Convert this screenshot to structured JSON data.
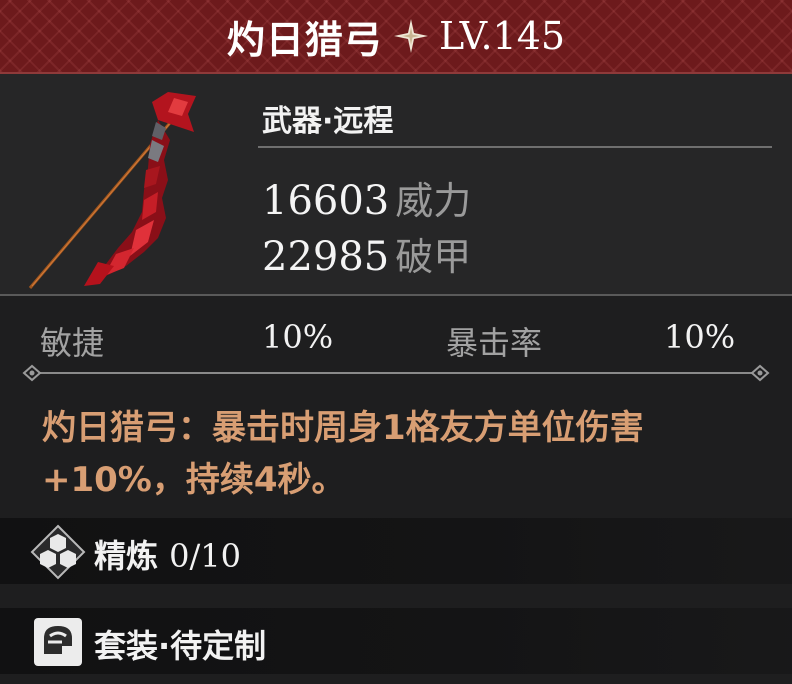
{
  "header": {
    "title": "灼日猎弓",
    "level": "LV.145",
    "star_icon": "sparkle-star-icon"
  },
  "item": {
    "image_icon": "red-crystal-bow-icon",
    "category": "武器·远程",
    "stats": [
      {
        "value": "16603",
        "label": "威力"
      },
      {
        "value": "22985",
        "label": "破甲"
      }
    ]
  },
  "attributes": [
    {
      "name": "敏捷",
      "value": "10%"
    },
    {
      "name": "暴击率",
      "value": "10%"
    }
  ],
  "description": {
    "text": "灼日猎弓：暴击时周身1格友方单位伤害+10%，持续4秒。"
  },
  "refine": {
    "label": "精炼",
    "value": "0/10",
    "icon": "refine-gems-icon"
  },
  "set": {
    "label": "套装·待定制",
    "icon": "set-helmet-icon"
  },
  "colors": {
    "header_red": "#6d1a1c",
    "description": "#d89e73",
    "background": "#1e1e1f"
  }
}
